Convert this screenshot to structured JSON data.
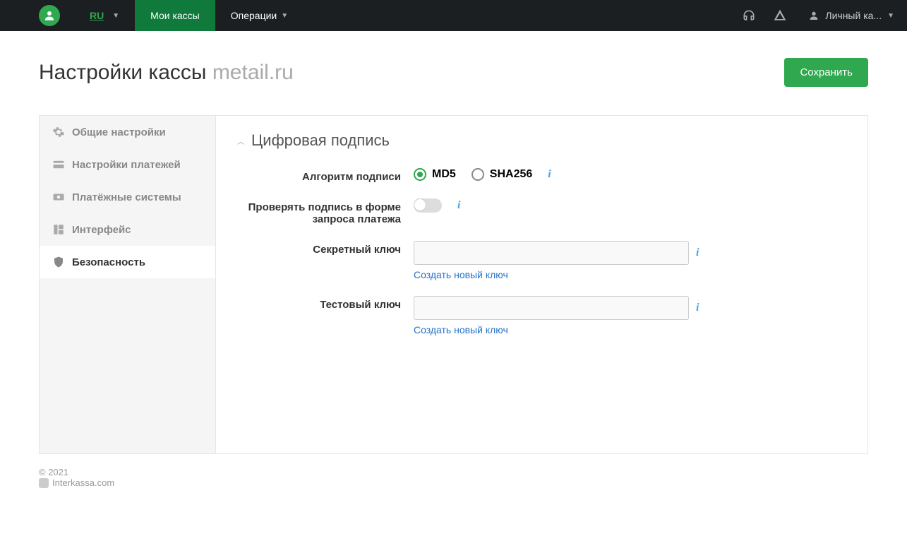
{
  "nav": {
    "lang": "RU",
    "items": [
      "Мои кассы",
      "Операции"
    ],
    "user": "Личный ка..."
  },
  "page": {
    "title": "Настройки кассы",
    "subtitle": "metail.ru",
    "save": "Сохранить"
  },
  "sidebar": {
    "items": [
      {
        "label": "Общие настройки",
        "icon": "gear"
      },
      {
        "label": "Настройки платежей",
        "icon": "card"
      },
      {
        "label": "Платёжные системы",
        "icon": "money"
      },
      {
        "label": "Интерфейс",
        "icon": "layout"
      },
      {
        "label": "Безопасность",
        "icon": "shield"
      }
    ]
  },
  "section": {
    "title": "Цифровая подпись",
    "algo_label": "Алгоритм подписи",
    "algos": [
      "MD5",
      "SHA256"
    ],
    "verify_label": "Проверять подпись в форме запроса платежа",
    "secret_label": "Секретный ключ",
    "test_label": "Тестовый ключ",
    "new_key": "Создать новый ключ"
  },
  "footer": {
    "copyright": "© 2021",
    "link": "Interkassa.com"
  }
}
